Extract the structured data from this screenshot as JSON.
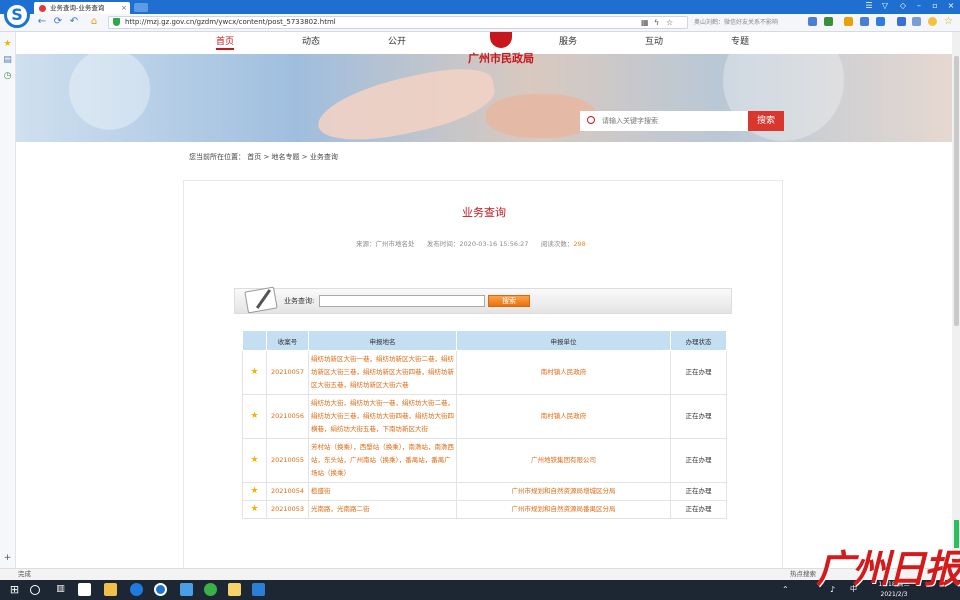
{
  "browser": {
    "tab_title": "业务查询-业务查询",
    "tab_close": "×",
    "url": "http://mzj.gz.gov.cn/gzdm/ywcx/content/post_5733802.html",
    "notice": "奥山刘鹤：微信好友关系不影响",
    "logo": "S",
    "status_text": "完成",
    "hot_search": "热点搜索"
  },
  "site": {
    "nav": [
      "首页",
      "动态",
      "公开",
      "服务",
      "互动",
      "专题"
    ],
    "title": "广州市民政局",
    "search_placeholder": "请输入关键字搜索",
    "search_button": "搜索"
  },
  "breadcrumb": "您当前所在位置： 首页 > 地名专题 > 业务查询",
  "article": {
    "title": "业务查询",
    "source_label": "来源：广州市地名处",
    "publish_label": "发布时间：2020-03-16 15:56:27",
    "views_label": "阅读次数：",
    "views": "298"
  },
  "query": {
    "label": "业务查询:",
    "button": "搜索"
  },
  "table": {
    "headers": [
      "",
      "收案号",
      "申报地名",
      "申报单位",
      "办理状态"
    ],
    "rows": [
      {
        "num": "20210057",
        "name": "绢纺坊新区大街一巷，绢纺坊新区大街二巷，绢纺坊新区大街三巷，绢纺坊新区大街四巷，绢纺坊新区大街五巷，绢纺坊新区大街六巷",
        "unit": "南村镇人民政府",
        "status": "正在办理"
      },
      {
        "num": "20210056",
        "name": "绢纺坊大街，绢纺坊大街一巷，绢纺坊大街二巷，绢纺坊大街三巷，绢纺坊大街四巷，绢纺坊大街四横巷，绢纺坊大街五巷，下南坊新区大街",
        "unit": "南村镇人民政府",
        "status": "正在办理"
      },
      {
        "num": "20210055",
        "name": "芳村站（换乘），西塱站（换乘），南漖站，南漖西站，东头站，广州南站（换乘），番禺站，番禺广场站（换乘）",
        "unit": "广州地铁集团有限公司",
        "status": "正在办理"
      },
      {
        "num": "20210054",
        "name": "榄盛街",
        "unit": "广州市规划和自然资源局增城区分局",
        "status": "正在办理"
      },
      {
        "num": "20210053",
        "name": "光南路，光南路二街",
        "unit": "广州市规划和自然资源局番禺区分局",
        "status": "正在办理"
      }
    ]
  },
  "taskbar": {
    "time": "18:18 周三",
    "date": "2021/2/3",
    "ime": "中"
  },
  "watermark": "广州日报"
}
